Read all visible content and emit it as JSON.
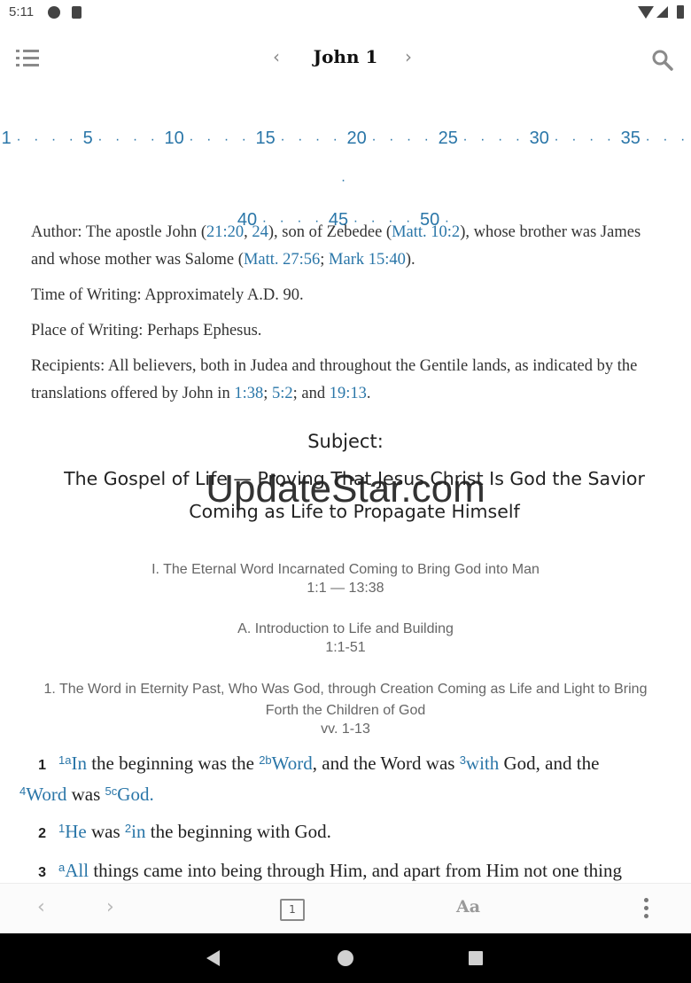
{
  "status_bar": {
    "time": "5:11"
  },
  "header": {
    "title": "John 1",
    "prev": "‹",
    "next": "›"
  },
  "verse_nav": {
    "row1": [
      "1",
      "5",
      "10",
      "15",
      "20",
      "25",
      "30",
      "35"
    ],
    "row2": [
      "40",
      "45",
      "50"
    ],
    "dots": "· · · ·"
  },
  "intro": {
    "author_prefix": "Author: The apostle John (",
    "author_ref1": "21:20",
    "sep1": ", ",
    "author_ref2": "24",
    "author_mid": "), son of Zebedee (",
    "author_ref3": "Matt. 10:2",
    "author_mid2": "), whose brother was James and whose mother was Salome (",
    "author_ref4": "Matt. 27:56",
    "sep2": "; ",
    "author_ref5": "Mark 15:40",
    "author_end": ").",
    "time": "Time of Writing: Approximately A.D. 90.",
    "place": "Place of Writing: Perhaps Ephesus.",
    "recipients_prefix": "Recipients: All believers, both in Judea and throughout the Gentile lands, as indicated by the translations offered by John in ",
    "rec_ref1": "1:38",
    "rec_sep1": "; ",
    "rec_ref2": "5:2",
    "rec_sep2": "; and ",
    "rec_ref3": "19:13",
    "rec_end": "."
  },
  "subject": {
    "label": "Subject:",
    "title": "The Gospel of Life — Proving That Jesus Christ Is God the Savior Coming as Life to Propagate Himself"
  },
  "watermark": "UpdateStar.com",
  "outline": [
    {
      "heading": "I. The Eternal Word Incarnated Coming to Bring God into Man",
      "range": "1:1 — 13:38"
    },
    {
      "heading": "A. Introduction to Life and Building",
      "range": "1:1-51"
    },
    {
      "heading": "1. The Word in Eternity Past, Who Was God, through Creation Coming as Life and Light to Bring Forth the Children of God",
      "range": "vv. 1-13"
    }
  ],
  "verses": {
    "v1": {
      "num": "1",
      "fn1": "1a",
      "w1": "In",
      "t1": " the beginning was the ",
      "fn2": "2b",
      "w2": "Word",
      "t2": ", and the Word was ",
      "fn3": "3",
      "w3": "with",
      "t3": " God, and the ",
      "fn4": "4",
      "w4": "Word",
      "t4": " was ",
      "fn5": "5c",
      "w5": "God."
    },
    "v2": {
      "num": "2",
      "fn1": "1",
      "w1": "He",
      "t1": " was ",
      "fn2": "2",
      "w2": "in",
      "t2": " the beginning with God."
    },
    "v3": {
      "num": "3",
      "fn1": "a",
      "w1": "All",
      "t1": " things came into being through Him, and apart from Him not one thing"
    }
  },
  "bottom_toolbar": {
    "back": "‹",
    "forward": "›",
    "page": "1",
    "font": "Aa"
  }
}
